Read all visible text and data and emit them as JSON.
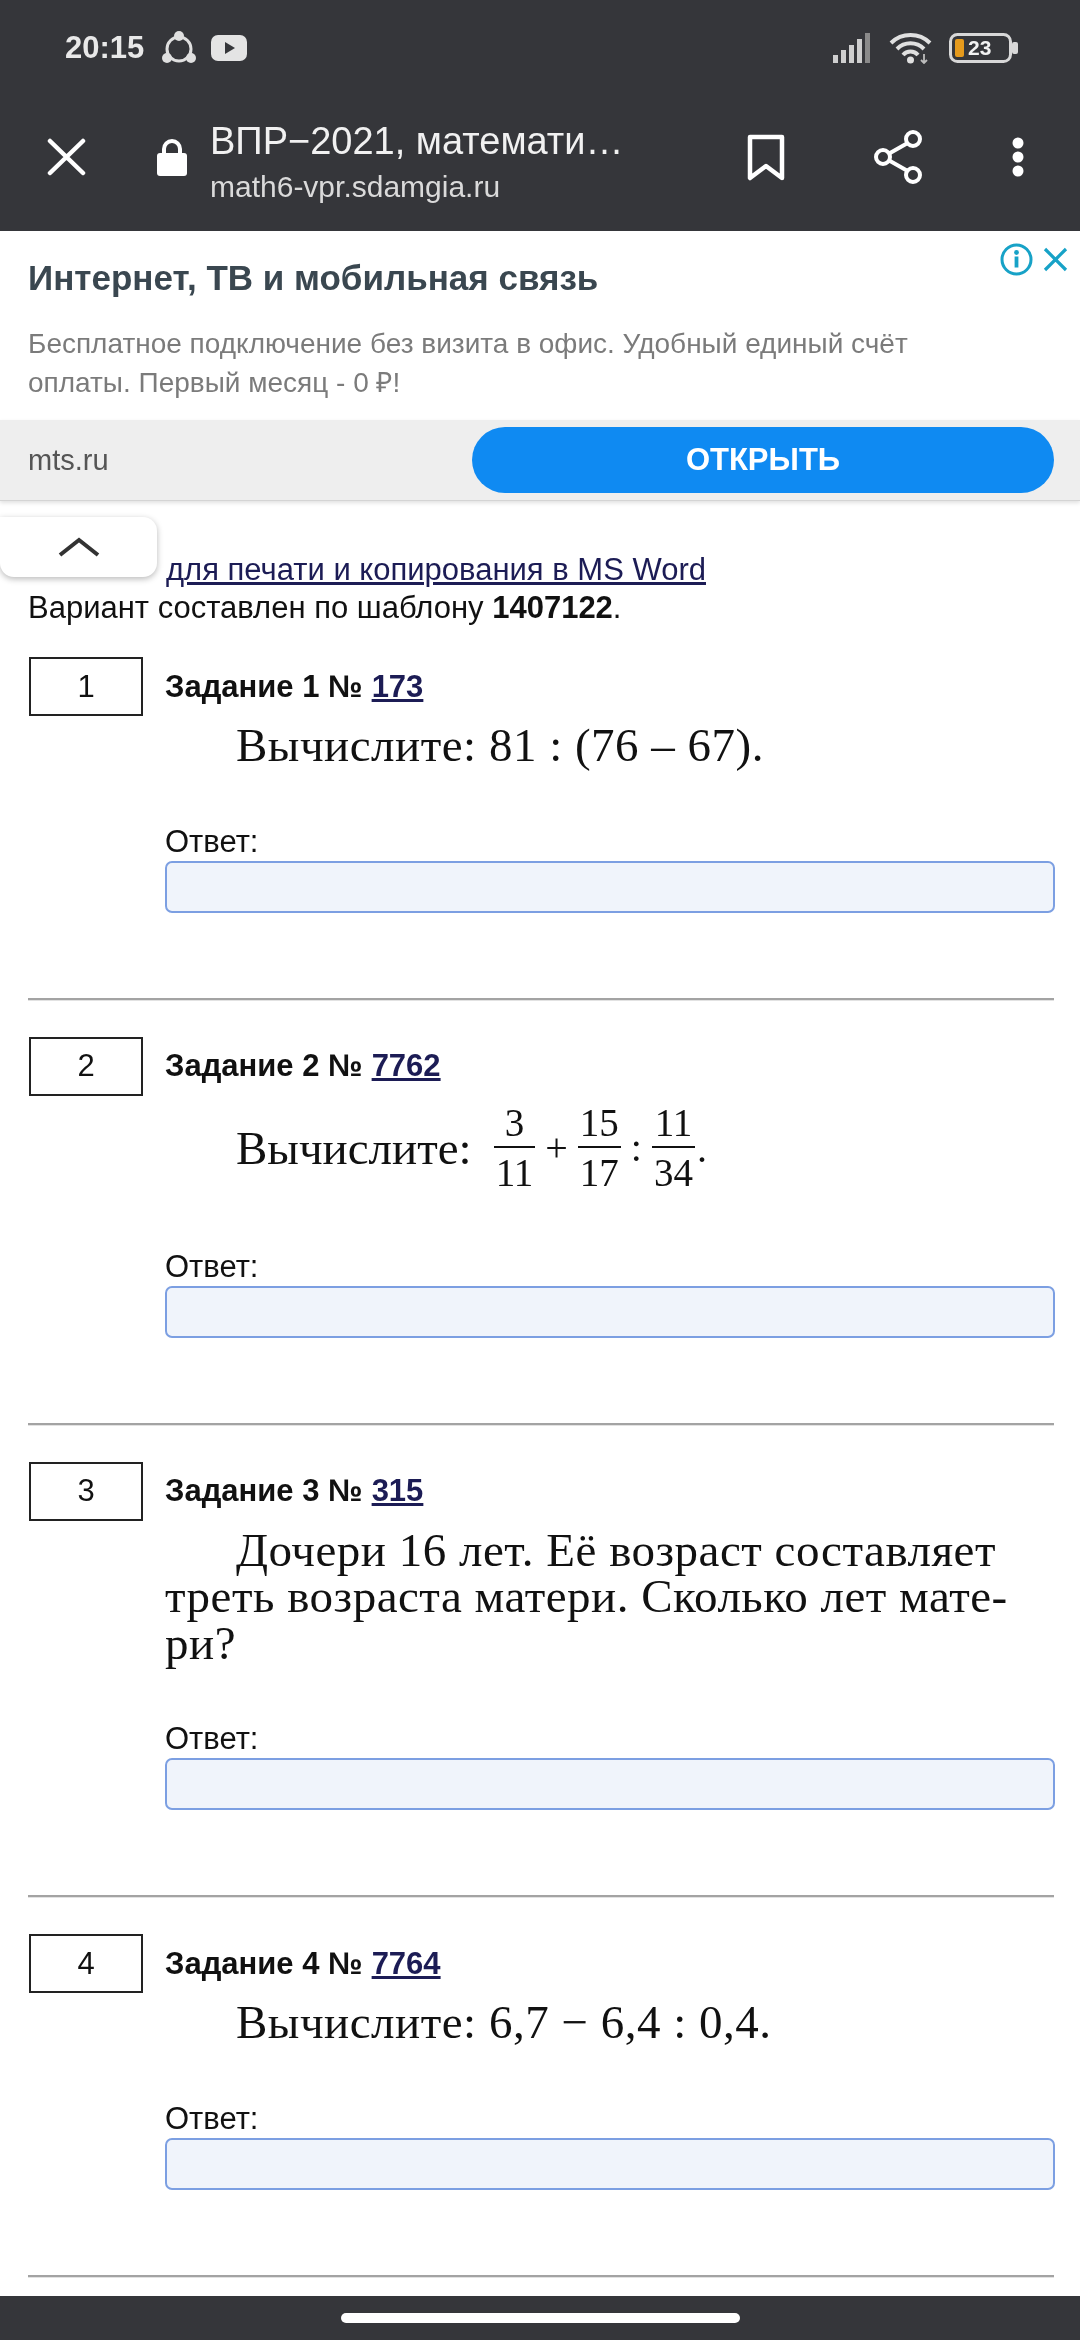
{
  "status_bar": {
    "time": "20:15",
    "battery": "23"
  },
  "browser_bar": {
    "title": "ВПР−2021, математи…",
    "url": "math6-vpr.sdamgia.ru"
  },
  "ad": {
    "title": "Интернет, ТВ и мобильная связь",
    "description": "Бесплатное подключение без визита в офис. Удобный единый счёт оплаты. Первый месяц - 0 ₽!",
    "domain": "mts.ru",
    "button": "ОТКРЫТЬ"
  },
  "page": {
    "print_link": "для печати и копирования в MS Word",
    "template_note": "Вариант составлен по шаблону **1407122**."
  },
  "tasks": [
    {
      "number": "1",
      "heading": "Задание 1 №",
      "link": "173",
      "kind": "text",
      "text": "Вычислите: 81 : (76 – 67).",
      "answer_label": "Ответ:"
    },
    {
      "number": "2",
      "heading": "Задание 2 №",
      "link": "7762",
      "kind": "expression",
      "lead": "Вычислите:",
      "terms": [
        {
          "numerator": "3",
          "denominator": "11",
          "sign": "+"
        },
        {
          "numerator": "15",
          "denominator": "17",
          "sign": ":"
        },
        {
          "numerator": "11",
          "denominator": "34",
          "sign": "."
        }
      ],
      "answer_label": "Ответ:"
    },
    {
      "number": "3",
      "heading": "Задание 3 №",
      "link": "315",
      "kind": "text",
      "text": "Дочери 16 лет. Её возраст составляет треть возраста матери. Сколько лет мате-ри?",
      "answer_label": "Ответ:"
    },
    {
      "number": "4",
      "heading": "Задание 4 №",
      "link": "7764",
      "kind": "text",
      "text": "Вычислите: 6,7 − 6,4 : 0,4.",
      "answer_label": "Ответ:"
    }
  ]
}
